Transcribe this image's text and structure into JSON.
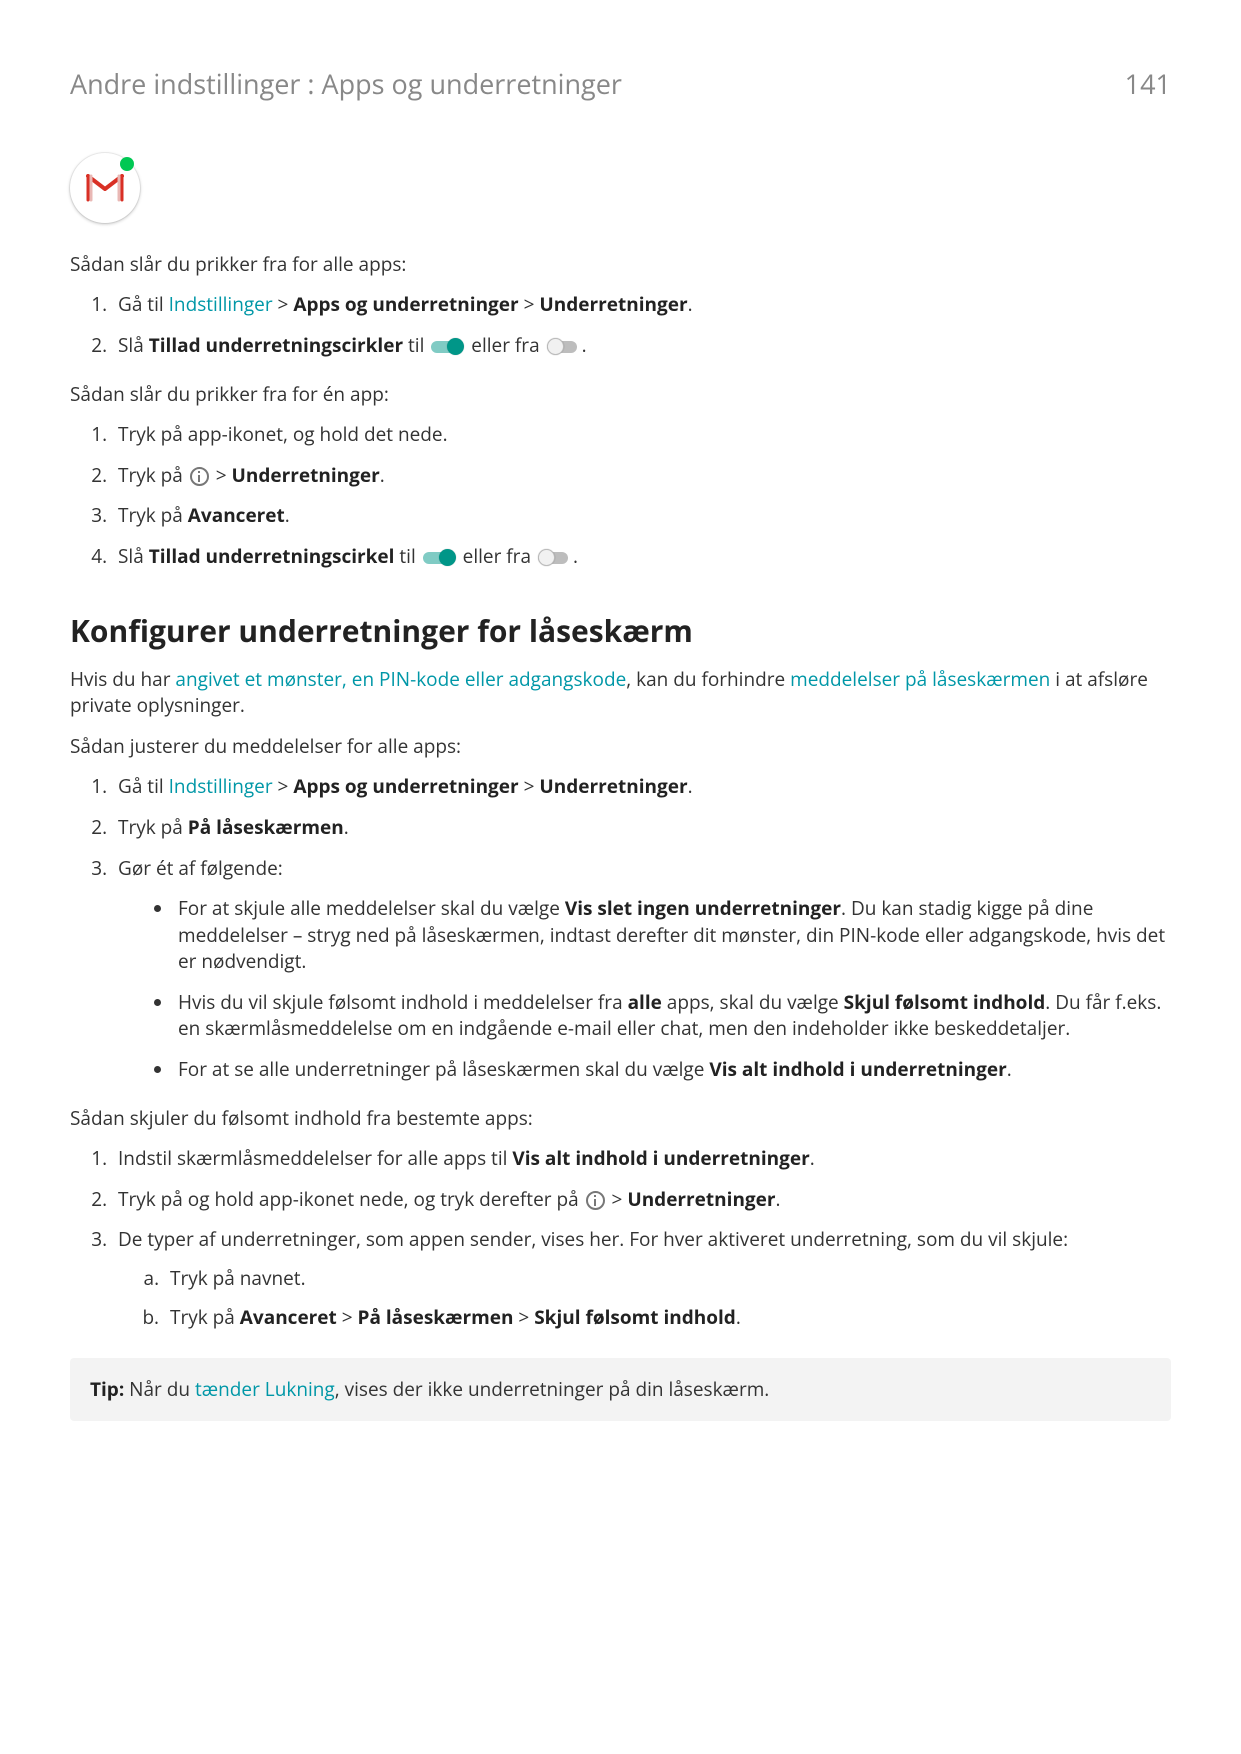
{
  "header": {
    "breadcrumb": "Andre indstillinger : Apps og underretninger",
    "page_number": "141"
  },
  "section_all_apps": {
    "intro": "Sådan slår du prikker fra for alle apps:",
    "step1_pre": "Gå til ",
    "step1_link": "Indstillinger",
    "step1_mid": " > ",
    "step1_b1": "Apps og underretninger",
    "step1_mid2": " > ",
    "step1_b2": "Underretninger",
    "step1_end": ".",
    "step2_pre": "Slå ",
    "step2_b": "Tillad underretningscirkler",
    "step2_mid": " til ",
    "step2_mid2": " eller fra ",
    "step2_end": "."
  },
  "section_one_app": {
    "intro": "Sådan slår du prikker fra for én app:",
    "step1": "Tryk på app-ikonet, og hold det nede.",
    "step2_pre": "Tryk på ",
    "step2_mid": " > ",
    "step2_b": "Underretninger",
    "step2_end": ".",
    "step3_pre": "Tryk på ",
    "step3_b": "Avanceret",
    "step3_end": ".",
    "step4_pre": "Slå ",
    "step4_b": "Tillad underretningscirkel",
    "step4_mid": " til ",
    "step4_mid2": " eller fra ",
    "step4_end": "."
  },
  "lockscreen": {
    "heading": "Konfigurer underretninger for låseskærm",
    "intro_pre": "Hvis du har ",
    "intro_link1": "angivet et mønster, en PIN-kode eller adgangskode",
    "intro_mid": ", kan du forhindre ",
    "intro_link2": "meddelelser på låseskærmen",
    "intro_end": " i at afsløre private oplysninger.",
    "adjust_intro": "Sådan justerer du meddelelser for alle apps:",
    "s1_pre": "Gå til ",
    "s1_link": "Indstillinger",
    "s1_mid": " > ",
    "s1_b1": "Apps og underretninger",
    "s1_mid2": " > ",
    "s1_b2": "Underretninger",
    "s1_end": ".",
    "s2_pre": "Tryk på ",
    "s2_b": "På låseskærmen",
    "s2_end": ".",
    "s3": "Gør ét af følgende:",
    "bullet1_pre": "For at skjule alle meddelelser skal du vælge ",
    "bullet1_b": "Vis slet ingen underretninger",
    "bullet1_end": ". Du kan stadig kigge på dine meddelelser – stryg ned på låseskærmen, indtast derefter dit mønster, din PIN-kode eller adgangskode, hvis det er nødvendigt.",
    "bullet2_pre": "Hvis du vil skjule følsomt indhold i meddelelser fra ",
    "bullet2_b1": "alle",
    "bullet2_mid": " apps, skal du vælge ",
    "bullet2_b2": "Skjul følsomt indhold",
    "bullet2_end": ". Du får f.eks. en skærmlåsmeddelelse om en indgående e-mail eller chat, men den indeholder ikke beskeddetaljer.",
    "bullet3_pre": "For at se alle underretninger på låseskærmen skal du vælge ",
    "bullet3_b": "Vis alt indhold i underretninger",
    "bullet3_end": ".",
    "hide_intro": "Sådan skjuler du følsomt indhold fra bestemte apps:",
    "h1_pre": "Indstil skærmlåsmeddelelser for alle apps til ",
    "h1_b": "Vis alt indhold i underretninger",
    "h1_end": ".",
    "h2_pre": "Tryk på og hold app-ikonet nede, og tryk derefter på ",
    "h2_mid": " > ",
    "h2_b": "Underretninger",
    "h2_end": ".",
    "h3": "De typer af underretninger, som appen sender, vises her. For hver aktiveret underretning, som du vil skjule:",
    "h3a": "Tryk på navnet.",
    "h3b_pre": "Tryk på ",
    "h3b_b1": "Avanceret",
    "h3b_mid": " > ",
    "h3b_b2": "På låseskærmen",
    "h3b_mid2": " > ",
    "h3b_b3": "Skjul følsomt indhold",
    "h3b_end": "."
  },
  "tip": {
    "label": "Tip:",
    "pre": " Når du ",
    "link": "tænder Lukning",
    "end": ", vises der ikke underretninger på din låseskærm."
  }
}
